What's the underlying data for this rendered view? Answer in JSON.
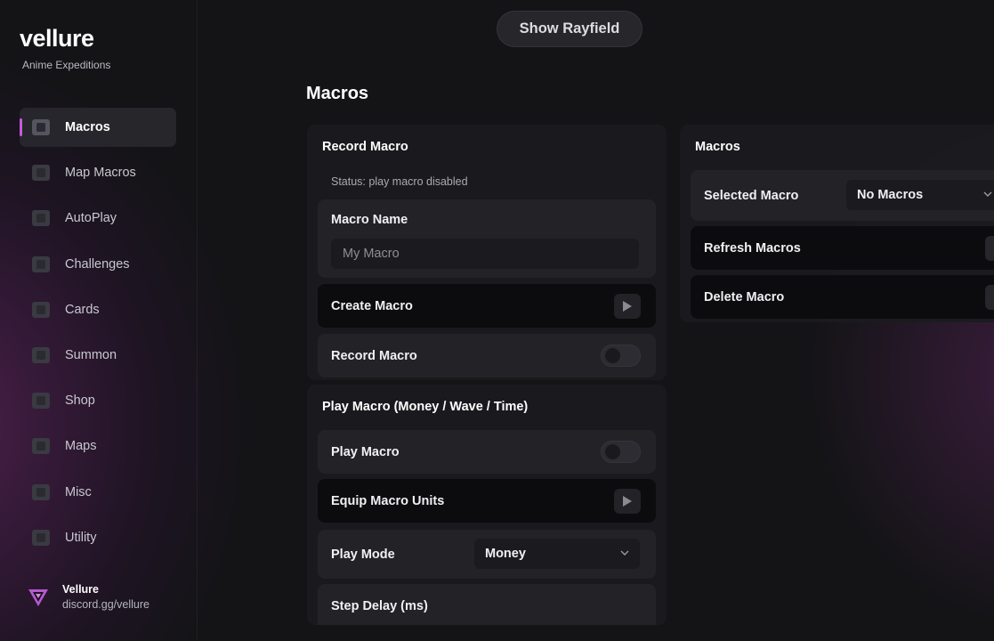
{
  "brand": {
    "title": "vellure",
    "subtitle": "Anime Expeditions"
  },
  "sidebar": {
    "items": [
      {
        "label": "Macros",
        "active": true
      },
      {
        "label": "Map Macros"
      },
      {
        "label": "AutoPlay"
      },
      {
        "label": "Challenges"
      },
      {
        "label": "Cards"
      },
      {
        "label": "Summon"
      },
      {
        "label": "Shop"
      },
      {
        "label": "Maps"
      },
      {
        "label": "Misc"
      },
      {
        "label": "Utility"
      }
    ]
  },
  "footer": {
    "name": "Vellure",
    "link": "discord.gg/vellure"
  },
  "top": {
    "show_button": "Show Rayfield"
  },
  "page": {
    "title": "Macros"
  },
  "record_section": {
    "title": "Record Macro",
    "status": "Status: play macro disabled",
    "macro_name_label": "Macro Name",
    "macro_name_placeholder": "My Macro",
    "create_label": "Create Macro",
    "record_label": "Record Macro",
    "record_on": false
  },
  "play_section": {
    "title": "Play Macro (Money / Wave / Time)",
    "play_label": "Play Macro",
    "play_on": false,
    "equip_label": "Equip Macro Units",
    "mode_label": "Play Mode",
    "mode_value": "Money",
    "delay_label": "Step Delay (ms)"
  },
  "macros_section": {
    "title": "Macros",
    "selected_label": "Selected Macro",
    "selected_value": "No Macros",
    "refresh_label": "Refresh Macros",
    "delete_label": "Delete Macro"
  },
  "colors": {
    "accent": "#c45ad8",
    "background": "#141417",
    "panel": "#1b1b1f",
    "row": "#222227"
  },
  "icons": {
    "play": "play-triangle-icon",
    "chevron": "chevron-down-icon",
    "logo": "vellure-logo-icon"
  }
}
